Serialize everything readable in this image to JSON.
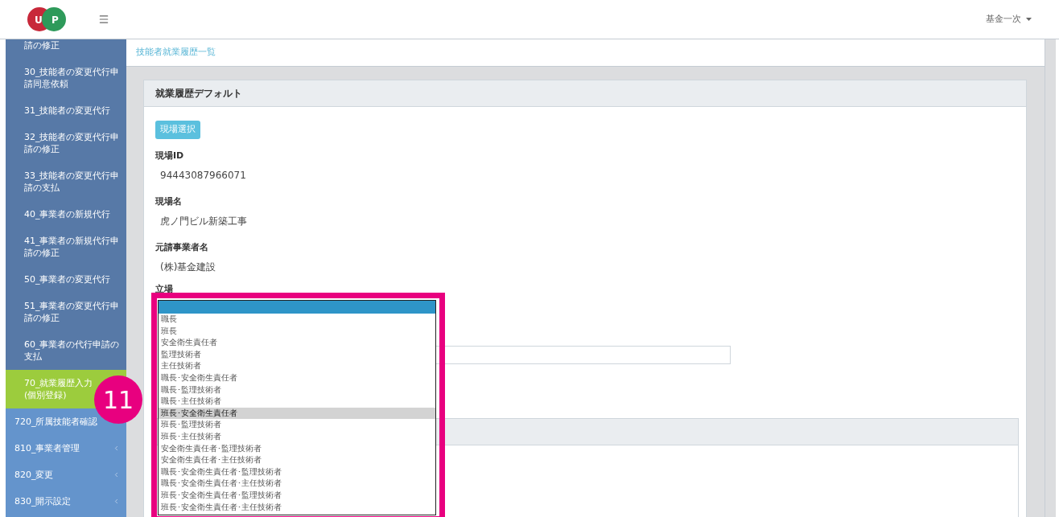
{
  "header": {
    "logo_letters": [
      "U",
      "P"
    ],
    "user_menu": "基金一次"
  },
  "sidebar": {
    "items": [
      {
        "label": "請の修正",
        "kind": "sub",
        "selected": false
      },
      {
        "label": "30_技能者の変更代行申請同意依頼",
        "kind": "sub",
        "selected": false
      },
      {
        "label": "31_技能者の変更代行",
        "kind": "sub",
        "selected": false
      },
      {
        "label": "32_技能者の変更代行申請の修正",
        "kind": "sub",
        "selected": false
      },
      {
        "label": "33_技能者の変更代行申請の支払",
        "kind": "sub",
        "selected": false
      },
      {
        "label": "40_事業者の新規代行",
        "kind": "sub",
        "selected": false
      },
      {
        "label": "41_事業者の新規代行申請の修正",
        "kind": "sub",
        "selected": false
      },
      {
        "label": "50_事業者の変更代行",
        "kind": "sub",
        "selected": false
      },
      {
        "label": "51_事業者の変更代行申請の修正",
        "kind": "sub",
        "selected": false
      },
      {
        "label": "60_事業者の代行申請の支払",
        "kind": "sub",
        "selected": false
      },
      {
        "label": "70_就業履歴入力\n(個別登録)",
        "kind": "sub",
        "selected": true
      },
      {
        "label": "720_所属技能者確認",
        "kind": "group",
        "selected": false
      },
      {
        "label": "810_事業者管理",
        "kind": "group",
        "selected": false
      },
      {
        "label": "820_変更",
        "kind": "group",
        "selected": false
      },
      {
        "label": "830_開示設定",
        "kind": "group",
        "selected": false
      }
    ]
  },
  "breadcrumb": "技能者就業履歴一覧",
  "card": {
    "title": "就業履歴デフォルト",
    "button": "現場選択",
    "fields": [
      {
        "label": "現場ID",
        "value": "94443087966071"
      },
      {
        "label": "現場名",
        "value": "虎ノ門ビル新築工事"
      },
      {
        "label": "元請事業者名",
        "value": "(株)基金建設"
      }
    ],
    "position_label": "立場"
  },
  "dropdown": {
    "options": [
      {
        "selected": true,
        "hovered": false
      },
      {
        "label": "職長",
        "selected": false,
        "hovered": false
      },
      {
        "label": "班長",
        "selected": false,
        "hovered": false
      },
      {
        "label": "安全衛生責任者",
        "selected": false,
        "hovered": false
      },
      {
        "label": "監理技術者",
        "selected": false,
        "hovered": false
      },
      {
        "label": "主任技術者",
        "selected": false,
        "hovered": false
      },
      {
        "label": "職長･安全衛生責任者",
        "selected": false,
        "hovered": false
      },
      {
        "label": "職長･監理技術者",
        "selected": false,
        "hovered": false
      },
      {
        "label": "職長･主任技術者",
        "selected": false,
        "hovered": false
      },
      {
        "label": "班長･安全衛生責任者",
        "selected": false,
        "hovered": true
      },
      {
        "label": "班長･監理技術者",
        "selected": false,
        "hovered": false
      },
      {
        "label": "班長･主任技術者",
        "selected": false,
        "hovered": false
      },
      {
        "label": "安全衛生責任者･監理技術者",
        "selected": false,
        "hovered": false
      },
      {
        "label": "安全衛生責任者･主任技術者",
        "selected": false,
        "hovered": false
      },
      {
        "label": "職長･安全衛生責任者･監理技術者",
        "selected": false,
        "hovered": false
      },
      {
        "label": "職長･安全衛生責任者･主任技術者",
        "selected": false,
        "hovered": false
      },
      {
        "label": "班長･安全衛生責任者･監理技術者",
        "selected": false,
        "hovered": false
      },
      {
        "label": "班長･安全衛生責任者･主任技術者",
        "selected": false,
        "hovered": false
      }
    ]
  },
  "callout": "11"
}
